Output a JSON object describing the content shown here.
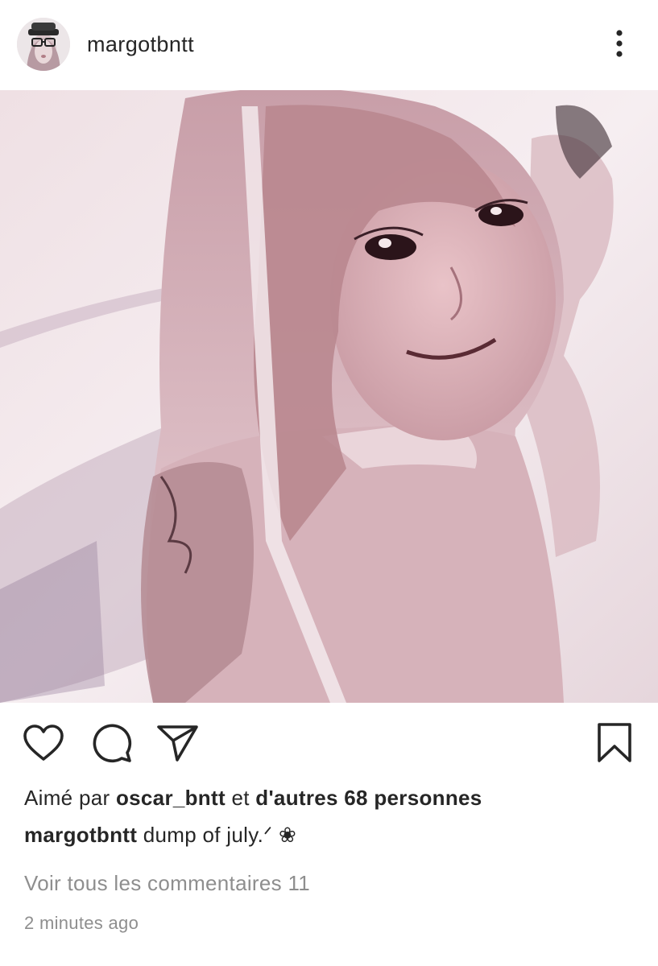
{
  "post": {
    "author": {
      "username": "margotbntt",
      "avatar_icon": "profile-photo"
    },
    "more_icon": "ellipsis-vertical-icon",
    "photo": {
      "tone_light": "#f4e8ec",
      "tone_mid": "#c9a3ad",
      "tone_dark": "#3a1f27"
    },
    "actions": {
      "like_icon": "heart-icon",
      "comment_icon": "comment-icon",
      "share_icon": "paper-plane-icon",
      "save_icon": "bookmark-icon"
    },
    "likes": {
      "prefix": "Aimé par",
      "liker": "oscar_bntt",
      "connector": "et",
      "others": "d'autres 68 personnes"
    },
    "caption": {
      "username": "margotbntt",
      "text": "dump of july.ᐟ ❀"
    },
    "view_comments": "Voir tous les commentaires 11",
    "timestamp": "2 minutes ago"
  }
}
